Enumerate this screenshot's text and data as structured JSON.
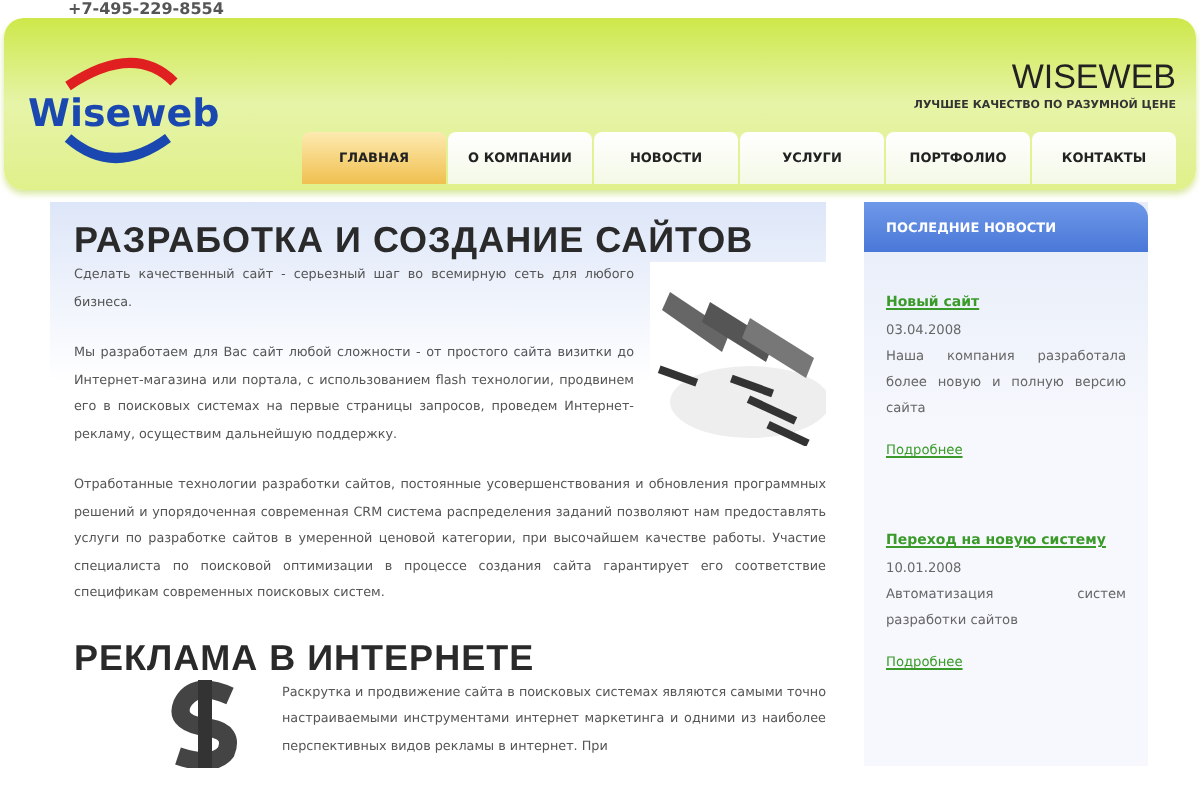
{
  "phone": "+7-495-229-8554",
  "header": {
    "logo": "Wiseweb",
    "title": "WISEWEB",
    "tagline": "ЛУЧШЕЕ КАЧЕСТВО ПО РАЗУМНОЙ ЦЕНЕ"
  },
  "nav": [
    {
      "label": "ГЛАВНАЯ",
      "selected": true
    },
    {
      "label": "О КОМПАНИИ",
      "selected": false
    },
    {
      "label": "НОВОСТИ",
      "selected": false
    },
    {
      "label": "УСЛУГИ",
      "selected": false
    },
    {
      "label": "ПОРТФОЛИО",
      "selected": false
    },
    {
      "label": "КОНТАКТЫ",
      "selected": false
    }
  ],
  "sections": [
    {
      "heading": "РАЗРАБОТКА И СОЗДАНИЕ САЙТОВ",
      "paragraphs": [
        "Сделать качественный сайт - серьезный шаг во всемирную сеть для любого бизнеса.",
        "Мы разработаем для Вас сайт любой сложности - от простого сайта визитки до Интернет-магазина или портала, с использованием flash технологии, продвинем его в поисковых системах на первые страницы запросов, проведем Интернет-рекламу, осуществим дальнейшую поддержку."
      ],
      "more": [
        "Отработанные технологии разработки сайтов, постоянные усовершенствования и обновления программных решений и упорядоченная современная CRM система распределения заданий позволяют нам предоставлять услуги по разработке сайтов в умеренной ценовой категории, при высочайшем качестве работы. Участие специалиста по поисковой оптимизации в процессе создания сайта гарантирует его соответствие спецификам современных поисковых систем."
      ]
    },
    {
      "heading": "РЕКЛАМА В ИНТЕРНЕТЕ",
      "paragraphs": [
        "Раскрутка и продвижение сайта в поисковых системах являются самыми точно настраиваемыми инструментами интернет маркетинга и одними из наиболее перспективных видов рекламы в интернет. При"
      ]
    }
  ],
  "sidebar": {
    "title": "ПОСЛЕДНИЕ НОВОСТИ",
    "news": [
      {
        "title": "Новый сайт",
        "date": "03.04.2008",
        "text": "Наша компания разработала более новую и полную версию сайта",
        "more": "Подробнее"
      },
      {
        "title": "Переход на новую систему",
        "date": "10.01.2008",
        "text": "Автоматизация систем разработки сайтов",
        "more": "Подробнее"
      }
    ]
  }
}
